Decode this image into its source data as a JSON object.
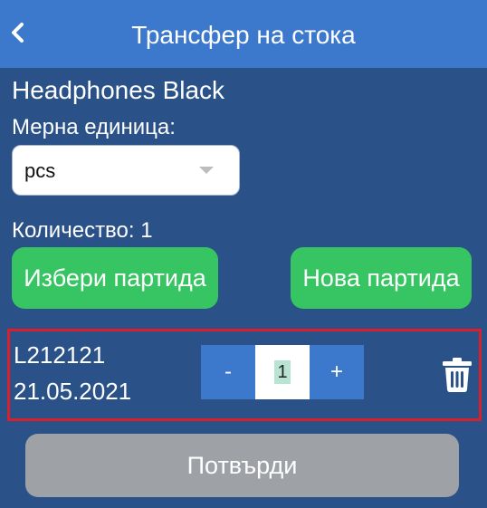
{
  "header": {
    "title": "Трансфер на стока",
    "back_icon": "chevron-left-icon"
  },
  "product": {
    "name": "Headphones Black"
  },
  "unit": {
    "label": "Мерна единица:",
    "selected": "pcs"
  },
  "quantity": {
    "label": "Количество: 1"
  },
  "actions": {
    "select_batch_label": "Избери партида",
    "new_batch_label": "Нова партида"
  },
  "batches": [
    {
      "code": "L212121",
      "date": "21.05.2021",
      "minus_label": "-",
      "plus_label": "+",
      "quantity": "1",
      "delete_icon": "trash-icon"
    }
  ],
  "footer": {
    "confirm_label": "Потвърди"
  },
  "colors": {
    "background": "#2a5288",
    "header": "#3c78cc",
    "green_button": "#36c562",
    "stepper": "#3c78cc",
    "confirm_disabled": "#9ea2a7",
    "highlight_border": "#d6202b"
  }
}
